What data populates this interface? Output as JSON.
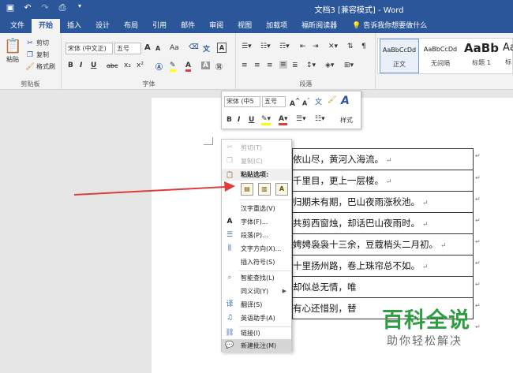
{
  "window": {
    "title": "文档3 [兼容模式] - Word"
  },
  "quick_access": [
    "save-icon",
    "undo-icon",
    "redo-icon",
    "print-preview-icon",
    "customize-icon"
  ],
  "tabs": [
    {
      "label": "文件",
      "active": false
    },
    {
      "label": "开始",
      "active": true
    },
    {
      "label": "插入",
      "active": false
    },
    {
      "label": "设计",
      "active": false
    },
    {
      "label": "布局",
      "active": false
    },
    {
      "label": "引用",
      "active": false
    },
    {
      "label": "邮件",
      "active": false
    },
    {
      "label": "审阅",
      "active": false
    },
    {
      "label": "视图",
      "active": false
    },
    {
      "label": "加载项",
      "active": false
    },
    {
      "label": "福昕阅读器",
      "active": false
    }
  ],
  "tell_me": "告诉我你想要做什么",
  "ribbon": {
    "clipboard": {
      "paste": "粘贴",
      "cut": "剪切",
      "copy": "复制",
      "format_painter": "格式刷",
      "label": "剪贴板"
    },
    "font": {
      "font_name": "宋体 (中文正)",
      "font_size": "五号",
      "bold": "B",
      "italic": "I",
      "underline": "U",
      "strike": "abc",
      "subscript": "x₂",
      "superscript": "x²",
      "grow": "A",
      "shrink": "A",
      "case": "Aa",
      "label": "字体"
    },
    "paragraph": {
      "label": "段落"
    },
    "styles": [
      {
        "sample": "AaBbCcDd",
        "name": "正文",
        "selected": true
      },
      {
        "sample": "AaBbCcDd",
        "name": "无间隔",
        "selected": false
      },
      {
        "sample": "AaBb",
        "name": "标题 1",
        "selected": false
      },
      {
        "sample": "Aa",
        "name": "标",
        "selected": false
      }
    ]
  },
  "mini_toolbar": {
    "font_name": "宋体 (中5",
    "font_size": "五号",
    "styles_label": "样式"
  },
  "context_menu": {
    "items_top": [
      {
        "label": "剪切(T)",
        "icon": "scissors-icon",
        "disabled": true
      },
      {
        "label": "复制(C)",
        "icon": "copy-icon",
        "disabled": true
      }
    ],
    "paste_header": "粘贴选项:",
    "paste_options": [
      "keep-source-format-icon",
      "merge-format-icon",
      "keep-text-only-icon"
    ],
    "items": [
      {
        "label": "汉字重选(V)",
        "icon": "",
        "submenu": false
      },
      {
        "label": "字体(F)...",
        "icon": "font-icon",
        "submenu": false
      },
      {
        "label": "段落(P)...",
        "icon": "paragraph-icon",
        "submenu": false
      },
      {
        "label": "文字方向(X)...",
        "icon": "text-direction-icon",
        "submenu": false
      },
      {
        "label": "插入符号(S)",
        "icon": "",
        "submenu": false
      },
      {
        "label": "智能查找(L)",
        "icon": "smart-lookup-icon",
        "submenu": false
      },
      {
        "label": "同义词(Y)",
        "icon": "",
        "submenu": true
      },
      {
        "label": "翻译(S)",
        "icon": "translate-icon",
        "submenu": false
      },
      {
        "label": "英语助手(A)",
        "icon": "english-assistant-icon",
        "submenu": false
      },
      {
        "label": "链接(I)",
        "icon": "link-icon",
        "submenu": false
      },
      {
        "label": "新建批注(M)",
        "icon": "new-comment-icon",
        "submenu": false,
        "hover": true
      }
    ]
  },
  "poem_rows": [
    "依山尽，黄河入海流。",
    "千里目，更上一层楼。",
    "归期未有期，巴山夜雨涨秋池。",
    "共剪西窗烛，却话巴山夜雨时。",
    "娉娉袅袅十三余，豆蔻梢头二月初。",
    "十里扬州路，卷上珠帘总不如。",
    "却似总无情，唯",
    "有心还惜别，替"
  ],
  "watermark": {
    "title": "百科全说",
    "subtitle": "助你轻松解决"
  },
  "colors": {
    "brand": "#2b579a",
    "arrow": "#e03c3c",
    "watermark": "#2f9e43"
  }
}
